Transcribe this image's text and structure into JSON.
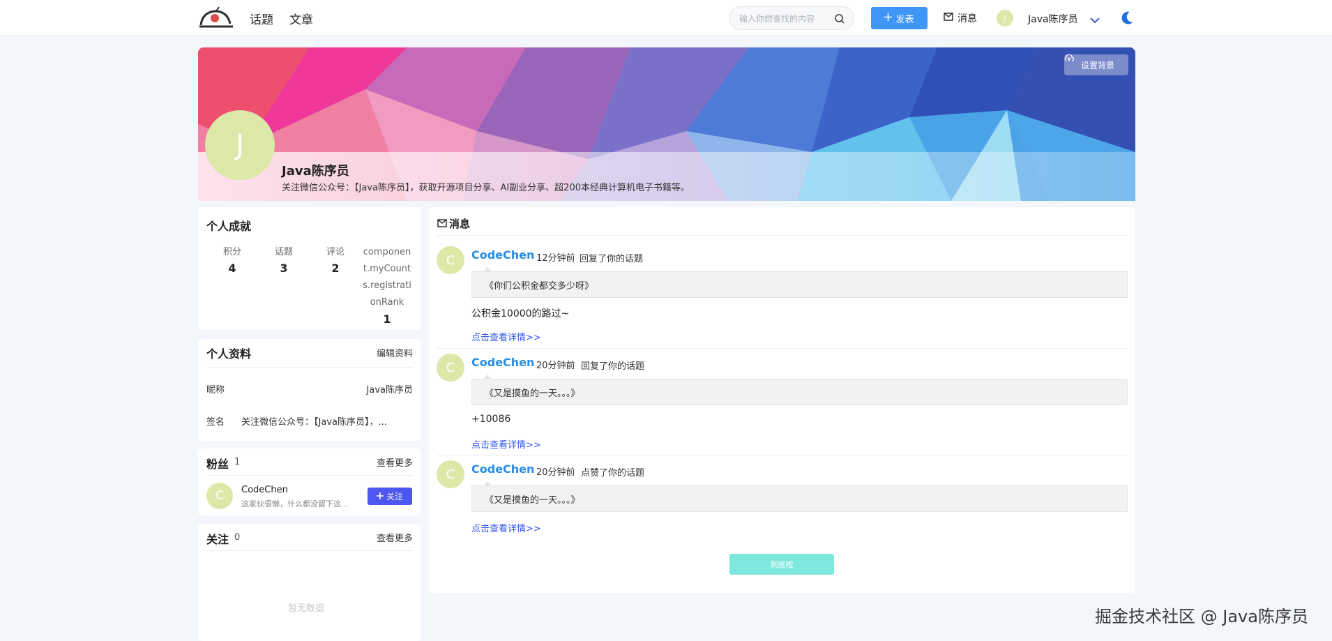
{
  "nav": {
    "links": [
      "话题",
      "文章"
    ],
    "search_placeholder": "输入你想查找的内容",
    "publish_label": "发表",
    "messages_label": "消息",
    "avatar_letter": "J",
    "user_name": "Java陈序员"
  },
  "banner": {
    "set_bg_label": "设置背景",
    "avatar_letter": "J",
    "name": "Java陈序员",
    "signature": "关注微信公众号：【Java陈序员】，获取开源项目分享、AI副业分享、超200本经典计算机电子书籍等。"
  },
  "achievements": {
    "title": "个人成就",
    "stats": [
      {
        "label": "积分",
        "value": "4"
      },
      {
        "label": "话题",
        "value": "3"
      },
      {
        "label": "评论",
        "value": "2"
      }
    ],
    "rank_label": "component.myCounts.registrationRank",
    "rank_value": "1"
  },
  "profile": {
    "title": "个人资料",
    "edit_label": "编辑资料",
    "nickname_label": "昵称",
    "nickname_value": "Java陈序员",
    "signature_label": "签名",
    "signature_value": "关注微信公众号：【Java陈序员】，..."
  },
  "fans": {
    "title": "粉丝",
    "count": "1",
    "more_label": "查看更多",
    "items": [
      {
        "letter": "C",
        "name": "CodeChen",
        "bio": "这家伙很懒，什么都没留下这...",
        "follow_label": "关注"
      }
    ]
  },
  "following": {
    "title": "关注",
    "count": "0",
    "more_label": "查看更多",
    "empty_label": "暂无数据"
  },
  "messages": {
    "title": "消息",
    "items": [
      {
        "letter": "C",
        "user": "CodeChen",
        "time": "12分钟前",
        "action": "回复了你的话题",
        "quote": "《你们公积金都交多少呀》",
        "text": "公积金10000的路过~",
        "link": "点击查看详情>>"
      },
      {
        "letter": "C",
        "user": "CodeChen",
        "time": "20分钟前",
        "action": "回复了你的话题",
        "quote": "《又是摸鱼的一天。。。》",
        "text": "+10086",
        "link": "点击查看详情>>"
      },
      {
        "letter": "C",
        "user": "CodeChen",
        "time": "20分钟前",
        "action": "点赞了你的话题",
        "quote": "《又是摸鱼的一天。。。》",
        "text": "",
        "link": "点击查看详情>>"
      }
    ],
    "bottom_label": "到底啦"
  },
  "watermark": "掘金技术社区 @ Java陈序员",
  "colors": {
    "primary": "#4096f6",
    "follow": "#4e56f2",
    "username": "#2a8be0",
    "link": "#2f54eb",
    "avatar_bg": "#dbe8a7",
    "bottom_btn": "#7ee8dc"
  },
  "icons": [
    "logo-icon",
    "search-icon",
    "plus-icon",
    "mail-icon",
    "chevron-down-icon",
    "moon-icon",
    "cloud-upload-icon"
  ]
}
